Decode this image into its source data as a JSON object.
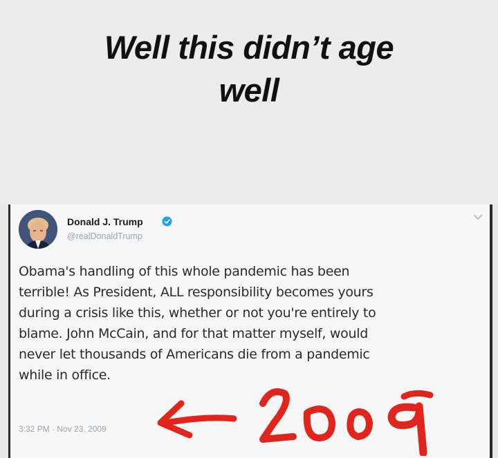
{
  "caption": {
    "line1": "Well this didn’t age",
    "line2": "well"
  },
  "tweet": {
    "author_name": "Donald J. Trump",
    "author_handle": "@realDonaldTrump",
    "text": "Obama's handling of this whole pandemic has been\nterrible! As President, ALL responsibility becomes yours\nduring a crisis like this, whether or not you're entirely to\nblame. John McCain, and for that matter myself, would\nnever let thousands of Americans die from a pandemic\nwhile in office.",
    "timestamp": "3:32 PM · Nov 23, 2009",
    "icons": [
      "verified-icon",
      "chevron-down-icon"
    ]
  },
  "annotation": {
    "handwritten_year": "2009",
    "color": "#e0261c"
  },
  "colors": {
    "verified": "#1da1f2",
    "handle": "#9ba4ad",
    "annotation": "#e0261c"
  }
}
